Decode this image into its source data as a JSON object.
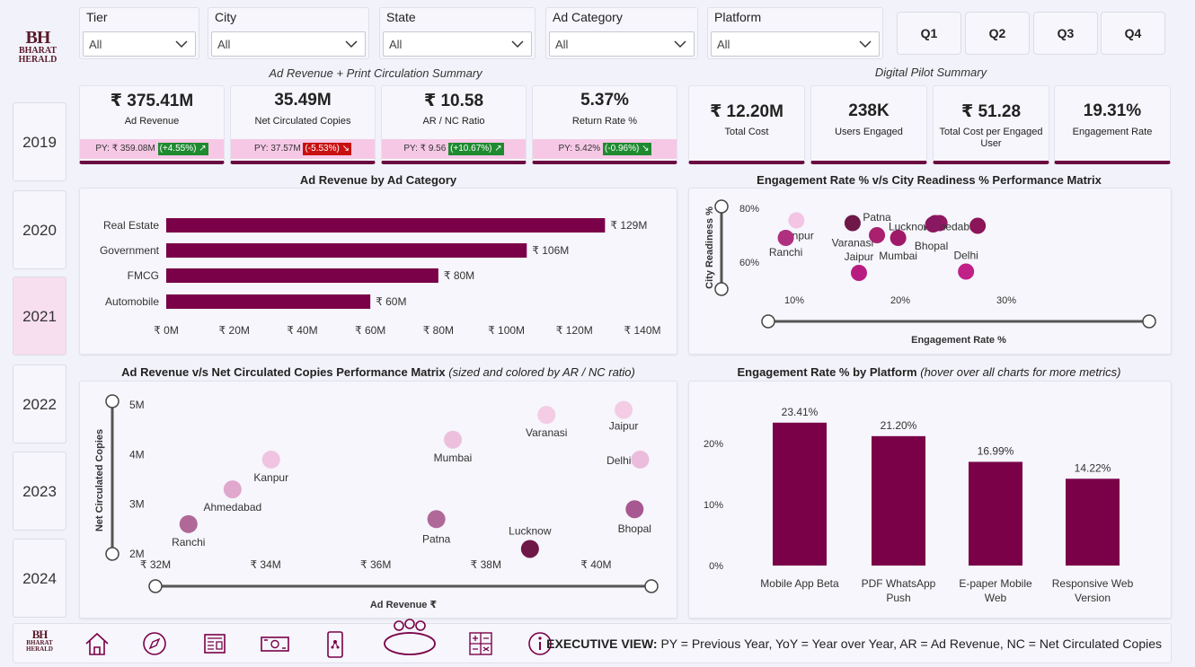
{
  "brand": {
    "mono": "BH",
    "line1": "BHARAT",
    "line2": "HERALD"
  },
  "filters": [
    {
      "label": "Tier",
      "value": "All"
    },
    {
      "label": "City",
      "value": "All"
    },
    {
      "label": "State",
      "value": "All"
    },
    {
      "label": "Ad Category",
      "value": "All"
    },
    {
      "label": "Platform",
      "value": "All"
    }
  ],
  "quarters": [
    "Q1",
    "Q2",
    "Q3",
    "Q4"
  ],
  "years": [
    {
      "label": "2019",
      "selected": false
    },
    {
      "label": "2020",
      "selected": false
    },
    {
      "label": "2021",
      "selected": true
    },
    {
      "label": "2022",
      "selected": false
    },
    {
      "label": "2023",
      "selected": false
    },
    {
      "label": "2024",
      "selected": false
    }
  ],
  "sections": {
    "print_summary": "Ad Revenue + Print Circulation Summary",
    "digital_summary": "Digital Pilot Summary"
  },
  "kpis": [
    {
      "value": "₹ 375.41M",
      "label": "Ad Revenue",
      "py": "PY: ₹ 359.08M",
      "change": "(+4.55%)",
      "arrow": "↗",
      "direction": "up"
    },
    {
      "value": "35.49M",
      "label": "Net Circulated Copies",
      "py": "PY: 37.57M",
      "change": "(-5.53%)",
      "arrow": "↘",
      "direction": "down"
    },
    {
      "value": "₹ 10.58",
      "label": "AR / NC Ratio",
      "py": "PY: ₹ 9.56",
      "change": "(+10.67%)",
      "arrow": "↗",
      "direction": "up"
    },
    {
      "value": "5.37%",
      "label": "Return Rate %",
      "py": "PY: 5.42%",
      "change": "(-0.96%)",
      "arrow": "↘",
      "direction": "up"
    }
  ],
  "digital_kpis": [
    {
      "value": "₹ 12.20M",
      "label": "Total Cost"
    },
    {
      "value": "238K",
      "label": "Users Engaged"
    },
    {
      "value": "₹ 51.28",
      "label": "Total Cost per Engaged User"
    },
    {
      "value": "19.31%",
      "label": "Engagement Rate"
    }
  ],
  "chart_titles": {
    "bar": "Ad Revenue by Ad Category",
    "engagement_matrix": "Engagement Rate % v/s City Readiness % Performance Matrix",
    "revenue_matrix": "Ad Revenue v/s Net Circulated Copies Performance Matrix",
    "revenue_matrix_note": "(sized and colored by AR / NC ratio)",
    "platform": "Engagement Rate % by Platform",
    "platform_note": "(hover over all charts for more metrics)"
  },
  "colors": {
    "primary": "#7a0048",
    "kpi_py_bg": "#f7c8e6",
    "up": "#1f8a30",
    "down": "#c81010",
    "selected_year": "#f8dff0"
  },
  "chart_data": [
    {
      "type": "bar",
      "orientation": "horizontal",
      "categories": [
        "Real Estate",
        "Government",
        "FMCG",
        "Automobile"
      ],
      "values": [
        129,
        106,
        80,
        60
      ],
      "value_labels": [
        "₹ 129M",
        "₹ 106M",
        "₹ 80M",
        "₹ 60M"
      ],
      "xlim": [
        0,
        140
      ],
      "xticks": [
        "₹ 0M",
        "₹ 20M",
        "₹ 40M",
        "₹ 60M",
        "₹ 80M",
        "₹ 100M",
        "₹ 120M",
        "₹ 140M"
      ],
      "title": "Ad Revenue by Ad Category"
    },
    {
      "type": "scatter",
      "title": "Engagement Rate % v/s City Readiness % Performance Matrix",
      "xlabel": "Engagement Rate %",
      "ylabel": "City Readiness %",
      "xticks": [
        "10%",
        "20%",
        "30%"
      ],
      "yticks": [
        "80%",
        "60%"
      ],
      "xlim": [
        0,
        30
      ],
      "ylim": [
        52,
        82
      ],
      "points": [
        {
          "label": "Kanpur",
          "x": 10.2,
          "y": 75.5,
          "color": "#f4c4e4"
        },
        {
          "label": "Ranchi",
          "x": 9.2,
          "y": 69.0,
          "color": "#b03080"
        },
        {
          "label": "Varanasi",
          "x": 15.5,
          "y": 74.5,
          "color": "#6e1848"
        },
        {
          "label": "Patna",
          "x": 17.8,
          "y": 70.0,
          "color": "#a8206e"
        },
        {
          "label": "Jaipur",
          "x": 16.1,
          "y": 56.0,
          "color": "#b81c80"
        },
        {
          "label": "Mumbai",
          "x": 19.8,
          "y": 69.0,
          "color": "#a01868"
        },
        {
          "label": "Lucknow",
          "x": 23.3,
          "y": 74.5,
          "color": "#8c1458"
        },
        {
          "label": "Ahmedabad",
          "x": 23.7,
          "y": 74.5,
          "color": "#901860"
        },
        {
          "label": "Bhopal",
          "x": 23.1,
          "y": 74.0,
          "color": "#8a1860"
        },
        {
          "label": "Delhi",
          "x": 26.2,
          "y": 56.5,
          "color": "#c02088"
        },
        {
          "label": "",
          "x": 27.3,
          "y": 73.5,
          "color": "#8c1458"
        }
      ]
    },
    {
      "type": "scatter",
      "title": "Ad Revenue v/s Net Circulated Copies Performance Matrix",
      "xlabel": "Ad Revenue ₹",
      "ylabel": "Net Circulated Copies",
      "xticks": [
        "₹ 32M",
        "₹ 34M",
        "₹ 36M",
        "₹ 38M",
        "₹ 40M"
      ],
      "yticks": [
        "5M",
        "4M",
        "3M",
        "2M"
      ],
      "xlim": [
        32,
        40.8
      ],
      "ylim": [
        2,
        5
      ],
      "points": [
        {
          "label": "Ranchi",
          "x": 32.6,
          "y": 2.6,
          "color": "#b06898"
        },
        {
          "label": "Ahmedabad",
          "x": 33.4,
          "y": 3.3,
          "color": "#e0a8cc"
        },
        {
          "label": "Kanpur",
          "x": 34.1,
          "y": 3.9,
          "color": "#f0c4e0"
        },
        {
          "label": "Mumbai",
          "x": 37.4,
          "y": 4.3,
          "color": "#ecc0dc"
        },
        {
          "label": "Patna",
          "x": 37.1,
          "y": 2.7,
          "color": "#b06898"
        },
        {
          "label": "Varanasi",
          "x": 39.1,
          "y": 4.8,
          "color": "#f4cce4"
        },
        {
          "label": "Jaipur",
          "x": 40.5,
          "y": 4.9,
          "color": "#f4cce4"
        },
        {
          "label": "Lucknow",
          "x": 38.8,
          "y": 2.1,
          "color": "#6e1848"
        },
        {
          "label": "Delhi",
          "x": 40.8,
          "y": 3.9,
          "color": "#ecbcdc"
        },
        {
          "label": "Bhopal",
          "x": 40.7,
          "y": 2.9,
          "color": "#a85890"
        }
      ]
    },
    {
      "type": "bar",
      "title": "Engagement Rate % by Platform",
      "categories": [
        "Mobile App Beta",
        "PDF WhatsApp Push",
        "E-paper Mobile Web",
        "Responsive Web Version"
      ],
      "values": [
        23.41,
        21.2,
        16.99,
        14.22
      ],
      "value_labels": [
        "23.41%",
        "21.20%",
        "16.99%",
        "14.22%"
      ],
      "ylim": [
        0,
        26
      ],
      "yticks": [
        "0%",
        "10%",
        "20%"
      ]
    }
  ],
  "nav": [
    {
      "name": "home-nav-icon",
      "glyph": "home"
    },
    {
      "name": "compass-nav-icon",
      "glyph": "compass"
    },
    {
      "name": "newspaper-nav-icon",
      "glyph": "news"
    },
    {
      "name": "money-nav-icon",
      "glyph": "money"
    },
    {
      "name": "mobile-nav-icon",
      "glyph": "mobile"
    },
    {
      "name": "meeting-nav-icon",
      "glyph": "meeting"
    },
    {
      "name": "calculator-nav-icon",
      "glyph": "calc"
    },
    {
      "name": "info-nav-icon",
      "glyph": "info"
    }
  ],
  "footer": {
    "bold": "EXECUTIVE VIEW:",
    "text": " PY = Previous Year, YoY = Year over Year, AR = Ad Revenue, NC = Net Circulated Copies"
  }
}
